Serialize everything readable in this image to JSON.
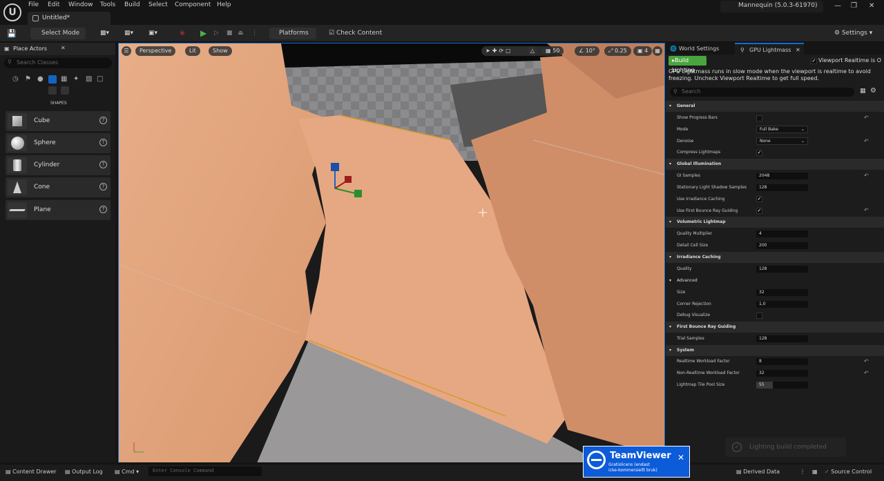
{
  "menu": [
    "File",
    "Edit",
    "Window",
    "Tools",
    "Build",
    "Select",
    "Component",
    "Help"
  ],
  "doc_tab": "Untitled*",
  "project": "Mannequin  (5.0.3-61970)",
  "toolbar": {
    "select_mode": "Select Mode",
    "platforms": "Platforms",
    "check_content": "Check Content",
    "settings": "Settings"
  },
  "place_actors": {
    "tab": "Place Actors",
    "search_placeholder": "Search Classes",
    "section": "SHAPES",
    "shapes": [
      "Cube",
      "Sphere",
      "Cylinder",
      "Cone",
      "Plane"
    ]
  },
  "viewport": {
    "perspective": "Perspective",
    "lit": "Lit",
    "show": "Show",
    "grid": "50",
    "angle": "10°",
    "scale": "0.25",
    "camspeed": "4"
  },
  "right": {
    "tab_world": "World Settings",
    "tab_gpu": "GPU Lightmass",
    "build_btn": "Build Lighting",
    "viewport_realtime": "Viewport Realtime is O",
    "desc": "GPU Lightmass runs in slow mode when the viewport is realtime to avoid freezing. Uncheck Viewport Realtime to get full speed.",
    "search_placeholder": "Search",
    "sections": {
      "general": "General",
      "gi": "Global Illumination",
      "vol": "Volumetric Lightmap",
      "irr": "Irradiance Caching",
      "adv": "Advanced",
      "fbrg": "First Bounce Ray Guiding",
      "sys": "System"
    },
    "props": {
      "show_progress": "Show Progress Bars",
      "mode": "Mode",
      "mode_val": "Full Bake",
      "denoise": "Denoise",
      "denoise_val": "None",
      "compress": "Compress Lightmaps",
      "gi_samples": "GI Samples",
      "gi_samples_val": "2048",
      "stat_shadow": "Stationary Light Shadow Samples",
      "stat_shadow_val": "128",
      "use_irr": "Use Irradiance Caching",
      "use_fbrg": "Use First Bounce Ray Guiding",
      "quality_mult": "Quality Multiplier",
      "quality_mult_val": "4",
      "detail_cell": "Detail Cell Size",
      "detail_cell_val": "200",
      "quality": "Quality",
      "quality_val": "128",
      "size": "Size",
      "size_val": "32",
      "corner": "Corner Rejection",
      "corner_val": "1,0",
      "debug_vis": "Debug Visualize",
      "trial": "Trial Samples",
      "trial_val": "128",
      "rt_factor": "Realtime Workload Factor",
      "rt_factor_val": "8",
      "nrt_factor": "Non-Realtime Workload Factor",
      "nrt_factor_val": "32",
      "pool": "Lightmap Tile Pool Size",
      "pool_val": "55"
    }
  },
  "bottom": {
    "content_drawer": "Content Drawer",
    "output_log": "Output Log",
    "cmd": "Cmd",
    "console_placeholder": "Enter Console Command",
    "derived": "Derived Data",
    "source": "Source Control"
  },
  "teamviewer": {
    "title": "TeamViewer",
    "line1": "Gratislicens (endast",
    "line2": "icke-kommersiellt bruk)"
  },
  "toast": "Lighting build completed"
}
